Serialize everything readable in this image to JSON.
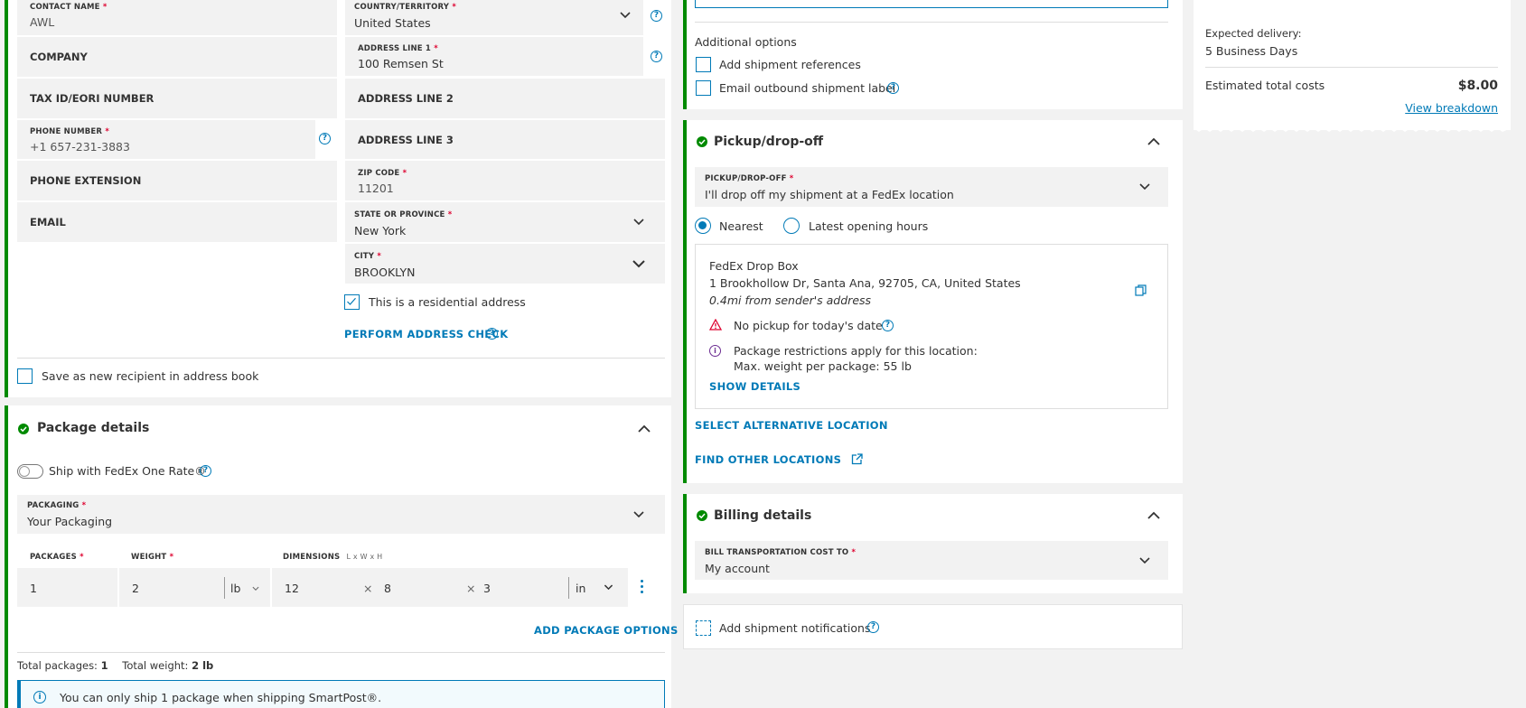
{
  "recipient": {
    "contact_name_label": "CONTACT NAME",
    "contact_name_value": "AWL",
    "company_label": "COMPANY",
    "tax_id_label": "TAX ID/EORI NUMBER",
    "phone_label": "PHONE NUMBER",
    "phone_value": "+1 657-231-3883",
    "phone_ext_label": "PHONE EXTENSION",
    "email_label": "EMAIL",
    "country_label": "COUNTRY/TERRITORY",
    "country_value": "United States",
    "address1_label": "ADDRESS LINE 1",
    "address1_value": "100 Remsen St",
    "address2_label": "ADDRESS LINE 2",
    "address3_label": "ADDRESS LINE 3",
    "zip_label": "ZIP CODE",
    "zip_value": "11201",
    "state_label": "STATE OR PROVINCE",
    "state_value": "New York",
    "city_label": "CITY",
    "city_value": "BROOKLYN",
    "residential_label": "This is a residential address",
    "residential_checked": true,
    "address_check_link": "PERFORM ADDRESS CHECK",
    "save_recipient_label": "Save as new recipient in address book"
  },
  "package": {
    "title": "Package details",
    "one_rate_label": "Ship with FedEx One Rate®",
    "packaging_label": "PACKAGING",
    "packaging_value": "Your Packaging",
    "packages_label": "PACKAGES",
    "weight_label": "WEIGHT",
    "dimensions_label": "DIMENSIONS",
    "dimensions_hint": "L x W x H",
    "packages_value": "1",
    "weight_value": "2",
    "weight_unit": "lb",
    "dim_l": "12",
    "dim_w": "8",
    "dim_h": "3",
    "dim_unit": "in",
    "add_options_link": "ADD PACKAGE OPTIONS",
    "total_packages_label": "Total packages:",
    "total_packages_value": "1",
    "total_weight_label": "Total weight:",
    "total_weight_value": "2 lb",
    "info_text": "You can only ship 1 package when shipping SmartPost®."
  },
  "additional": {
    "title": "Additional options",
    "references_label": "Add shipment references",
    "email_label_label": "Email outbound shipment label"
  },
  "pickup": {
    "title": "Pickup/drop-off",
    "select_label": "PICKUP/DROP-OFF",
    "select_value": "I'll drop off my shipment at a FedEx location",
    "radio_nearest": "Nearest",
    "radio_latest": "Latest opening hours",
    "location_name": "FedEx Drop Box",
    "location_address": "1 Brookhollow Dr, Santa Ana, 92705, CA, United States",
    "location_distance": "0.4mi from sender's address",
    "warning_text": "No pickup for today's date",
    "restriction_line1": "Package restrictions apply for this location:",
    "restriction_line2": "Max. weight per package: 55 lb",
    "show_details": "SHOW DETAILS",
    "alt_location": "SELECT ALTERNATIVE LOCATION",
    "find_other": "FIND OTHER LOCATIONS"
  },
  "billing": {
    "title": "Billing details",
    "bill_label": "BILL TRANSPORTATION COST TO",
    "bill_value": "My account"
  },
  "notifications": {
    "label": "Add shipment notifications"
  },
  "summary": {
    "delivery_label": "Expected delivery:",
    "delivery_value": "5 Business Days",
    "total_label": "Estimated total costs",
    "total_value": "$8.00",
    "breakdown_link": "View breakdown"
  },
  "colors": {
    "accent": "#007ab7",
    "success": "#008a00",
    "required": "#de002e",
    "warning": "#de002e",
    "info": "#6b2c91"
  }
}
